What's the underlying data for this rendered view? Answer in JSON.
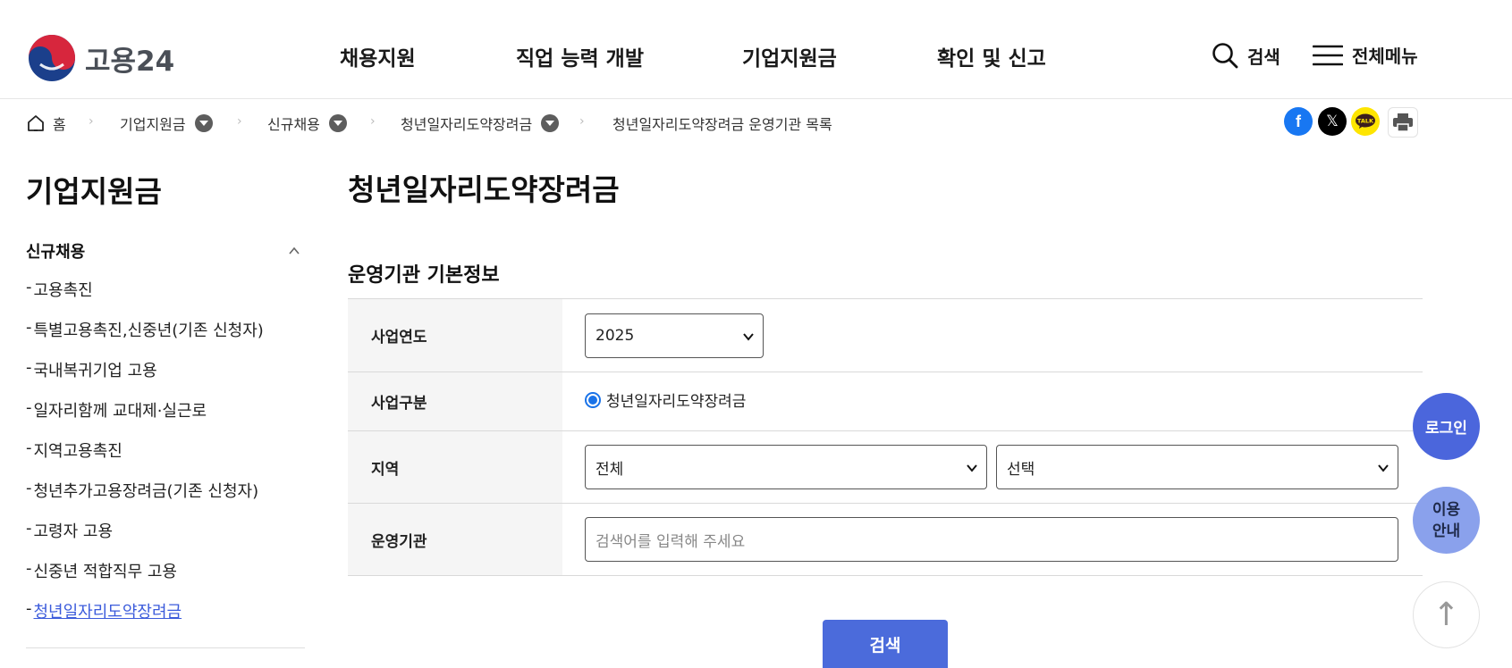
{
  "header": {
    "logo_text": "고용24",
    "nav": [
      "채용지원",
      "직업 능력 개발",
      "기업지원금",
      "확인 및 신고"
    ],
    "search_label": "검색",
    "menu_label": "전체메뉴"
  },
  "breadcrumb": {
    "home": "홈",
    "items": [
      "기업지원금",
      "신규채용",
      "청년일자리도약장려금",
      "청년일자리도약장려금 운영기관 목록"
    ]
  },
  "share": {
    "facebook_glyph": "f",
    "x_glyph": "𝕏",
    "kakao_text": "TALK"
  },
  "sidebar": {
    "title": "기업지원금",
    "group": "신규채용",
    "dash": "-",
    "items": [
      "고용촉진",
      "특별고용촉진,신중년(기존 신청자)",
      "국내복귀기업 고용",
      "일자리함께 교대제·실근로",
      "지역고용촉진",
      "청년추가고용장려금(기존 신청자)",
      "고령자 고용",
      "신중년 적합직무 고용",
      "청년일자리도약장려금"
    ],
    "active_index": 8
  },
  "main": {
    "title": "청년일자리도약장려금",
    "section_title": "운영기관 기본정보",
    "form": {
      "year_label": "사업연도",
      "year_value": "2025",
      "type_label": "사업구분",
      "type_option": "청년일자리도약장려금",
      "region_label": "지역",
      "region_value": "전체",
      "region_sub_value": "선택",
      "agency_label": "운영기관",
      "agency_placeholder": "검색어를 입력해 주세요"
    },
    "search_button": "검색"
  },
  "floating": {
    "login": "로그인",
    "guide_line1": "이용",
    "guide_line2": "안내",
    "top_glyph": "↑"
  },
  "colors": {
    "accent": "#4b6bdb",
    "login_fab": "#4b66dc",
    "guide_fab": "#8aa1ec",
    "active_link": "#3b5bdb",
    "facebook": "#1877f2",
    "kakao": "#fee500"
  }
}
